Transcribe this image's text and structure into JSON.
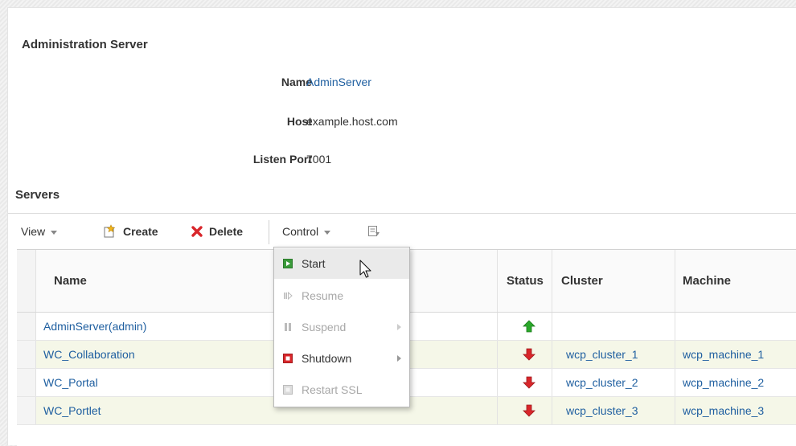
{
  "admin": {
    "title": "Administration Server",
    "name_label": "Name",
    "name_value": "AdminServer",
    "host_label": "Host",
    "host_value": "example.host.com",
    "port_label": "Listen Port",
    "port_value": "7001"
  },
  "servers": {
    "title": "Servers",
    "toolbar": {
      "view": "View",
      "create": "Create",
      "delete": "Delete",
      "control": "Control"
    },
    "columns": {
      "name": "Name",
      "status": "Status",
      "cluster": "Cluster",
      "machine": "Machine"
    },
    "rows": [
      {
        "name": "AdminServer(admin)",
        "status": "up",
        "cluster": "",
        "machine": ""
      },
      {
        "name": "WC_Collaboration",
        "status": "down",
        "cluster": "wcp_cluster_1",
        "machine": "wcp_machine_1"
      },
      {
        "name": "WC_Portal",
        "status": "down",
        "cluster": "wcp_cluster_2",
        "machine": "wcp_machine_2"
      },
      {
        "name": "WC_Portlet",
        "status": "down",
        "cluster": "wcp_cluster_3",
        "machine": "wcp_machine_3"
      }
    ]
  },
  "control_menu": {
    "items": [
      {
        "label": "Start",
        "enabled": true,
        "hover": true
      },
      {
        "label": "Resume",
        "enabled": false
      },
      {
        "label": "Suspend",
        "enabled": false,
        "submenu": true
      },
      {
        "label": "Shutdown",
        "enabled": true,
        "submenu": true
      },
      {
        "label": "Restart SSL",
        "enabled": false
      }
    ]
  },
  "colors": {
    "link": "#1f5fa0",
    "status_up": "#2aa82a",
    "status_down": "#d9262a",
    "alt_row": "#f5f7e8"
  }
}
